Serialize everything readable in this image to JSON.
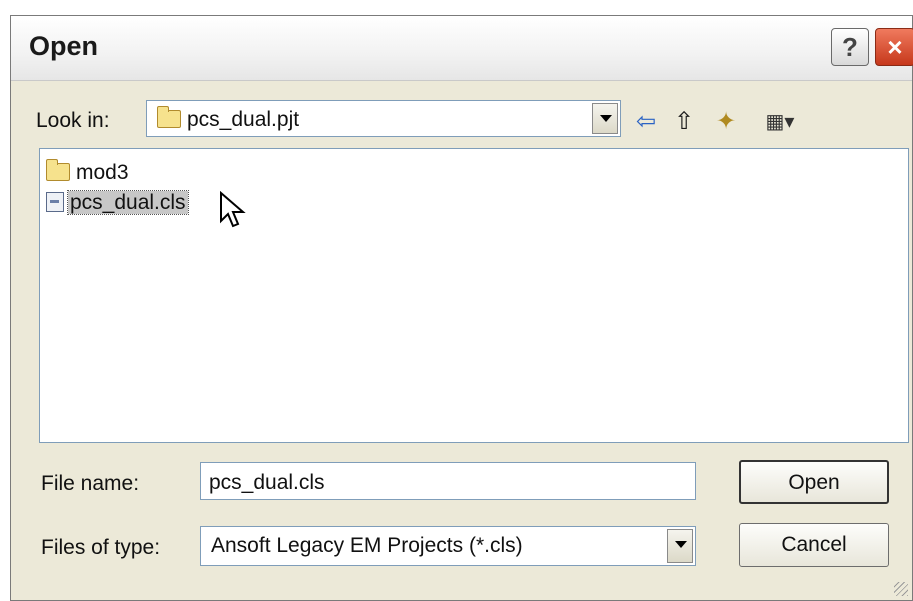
{
  "window": {
    "title": "Open"
  },
  "titlebar": {
    "help_glyph": "?",
    "close_glyph": "×"
  },
  "lookin": {
    "label": "Look in:",
    "value": "pcs_dual.pjt"
  },
  "toolbar": {
    "back_glyph": "⇦",
    "up_glyph": "⇧",
    "newfolder_glyph": "✦",
    "views_glyph": "▦▾"
  },
  "files": [
    {
      "name": "mod3",
      "icon": "folder-icon"
    },
    {
      "name": "pcs_dual.cls",
      "icon": "file-icon",
      "selected": true
    }
  ],
  "filename": {
    "label": "File name:",
    "value": "pcs_dual.cls"
  },
  "filetype": {
    "label": "Files of type:",
    "value": "Ansoft Legacy EM Projects (*.cls)"
  },
  "buttons": {
    "open": "Open",
    "cancel": "Cancel"
  }
}
